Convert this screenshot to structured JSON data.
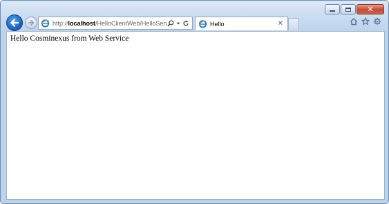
{
  "browser": {
    "address_bar": {
      "url_prefix": "http://",
      "url_host": "localhost",
      "url_path": "/HelloClientWeb/HelloServlet"
    },
    "tab": {
      "title": "Hello"
    },
    "icons": {
      "back": "back-arrow-icon",
      "forward": "forward-arrow-icon",
      "page": "ie-page-icon",
      "search": "search-icon",
      "refresh": "refresh-icon",
      "home": "home-icon",
      "favorites": "star-icon",
      "tools": "gear-icon"
    }
  },
  "page": {
    "body_text": "Hello Cosminexus from Web Service"
  },
  "colors": {
    "back_button": "#1660c0",
    "close_button": "#c24a34",
    "frame": "#c9dcf1"
  }
}
